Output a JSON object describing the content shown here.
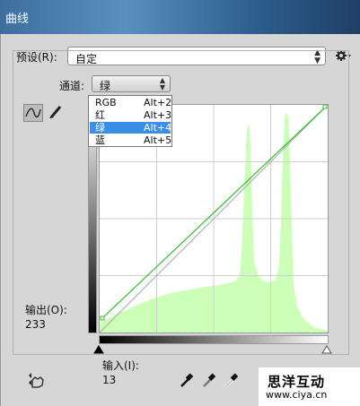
{
  "window": {
    "title": "曲线"
  },
  "preset": {
    "label": "预设(R):",
    "value": "自定"
  },
  "channel": {
    "label": "通道:",
    "value": "绿",
    "options": [
      {
        "name": "RGB",
        "shortcut": "Alt+2"
      },
      {
        "name": "红",
        "shortcut": "Alt+3"
      },
      {
        "name": "绿",
        "shortcut": "Alt+4"
      },
      {
        "name": "蓝",
        "shortcut": "Alt+5"
      }
    ],
    "selected_index": 2
  },
  "output": {
    "label": "输出(O):",
    "value": "233"
  },
  "input": {
    "label": "输入(I):",
    "value": "13"
  },
  "colors": {
    "histogram": "#ccffb8",
    "curve": "#2fbf2f",
    "menu_highlight": "#3a8ee6"
  },
  "curve_points": [
    {
      "in": 0,
      "out": 0
    },
    {
      "in": 255,
      "out": 255
    }
  ],
  "watermark": {
    "line1": "思洋互动",
    "line2": "www.ciya.cn"
  }
}
